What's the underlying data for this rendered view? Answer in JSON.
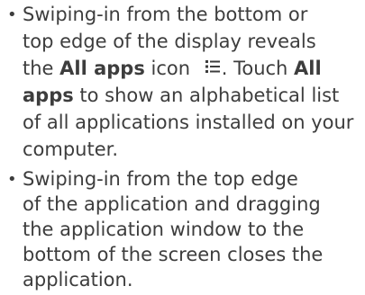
{
  "items": [
    {
      "lines": [
        "Swiping-in from the bottom or",
        "top edge of the display reveals",
        {
          "a": "the ",
          "b": "All apps",
          "c": " icon ",
          "d": ". Touch ",
          "e": "All"
        },
        {
          "b": "apps",
          "c": " to show an alphabetical list"
        },
        "of all applications installed on your",
        "computer."
      ],
      "icon": "all-apps-icon"
    },
    {
      "lines": [
        "Swiping-in from the top edge",
        "of the application and dragging",
        "the application window to the",
        "bottom of the screen closes the",
        "application."
      ]
    }
  ]
}
